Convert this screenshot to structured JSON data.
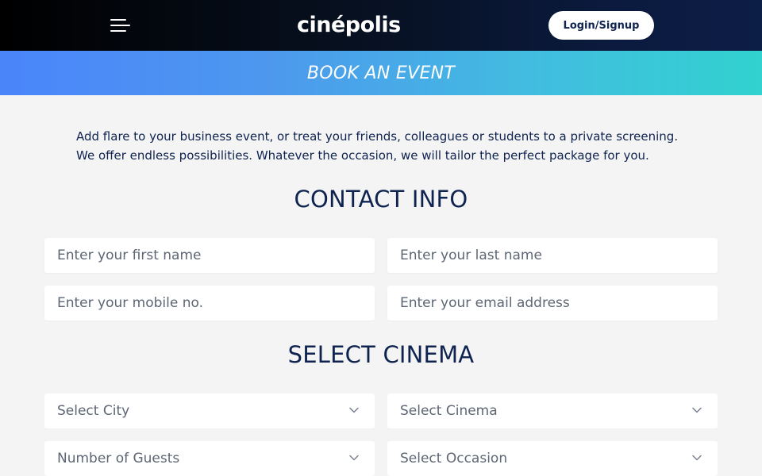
{
  "header": {
    "logo_text": "cinépolis",
    "login_label": "Login/Signup",
    "menu_icon": "hamburger-icon"
  },
  "banner": {
    "title": "BOOK AN EVENT"
  },
  "intro": {
    "line1": "Add flare to your business event, or treat your friends, colleagues or students to a private screening.",
    "line2": "We offer endless possibilities. Whatever the occasion, we will tailor the perfect package for you."
  },
  "contact": {
    "title": "CONTACT INFO",
    "first_name_placeholder": "Enter your first name",
    "last_name_placeholder": "Enter your last name",
    "mobile_placeholder": "Enter your mobile no.",
    "email_placeholder": "Enter your email address"
  },
  "cinema": {
    "title": "SELECT CINEMA",
    "city_label": "Select City",
    "cinema_label": "Select Cinema",
    "guests_label": "Number of Guests",
    "occasion_label": "Select Occasion",
    "chevron_icon": "chevron-down-icon"
  },
  "colors": {
    "navy_text": "#0f2350",
    "banner_start": "#4a85fb",
    "banner_end": "#31d2cf",
    "page_bg": "#f4f4f4"
  }
}
